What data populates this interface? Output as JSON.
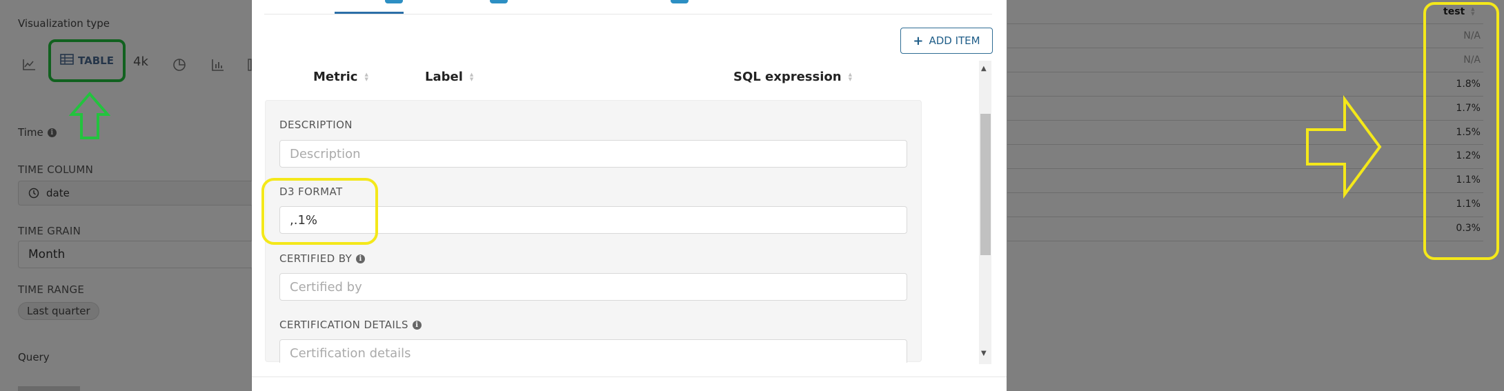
{
  "left_panel": {
    "visualization_type_label": "Visualization type",
    "table_button_label": "TABLE",
    "big_number_label": "4k",
    "time_section_label": "Time",
    "time_column_label": "TIME COLUMN",
    "time_column_value": "date",
    "time_grain_label": "TIME GRAIN",
    "time_grain_value": "Month",
    "time_range_label": "TIME RANGE",
    "time_range_value": "Last quarter",
    "query_section_label": "Query"
  },
  "modal": {
    "add_item_label": "ADD ITEM",
    "columns": [
      "Metric",
      "Label",
      "SQL expression"
    ],
    "description": {
      "label": "DESCRIPTION",
      "placeholder": "Description",
      "value": ""
    },
    "d3_format": {
      "label": "D3 FORMAT",
      "value": ",.1%"
    },
    "certified_by": {
      "label": "CERTIFIED BY",
      "placeholder": "Certified by",
      "value": ""
    },
    "certification_details": {
      "label": "CERTIFICATION DETAILS",
      "placeholder": "Certification details",
      "value": ""
    }
  },
  "results_table": {
    "header": "test",
    "rows": [
      "N/A",
      "N/A",
      "1.8%",
      "1.7%",
      "1.5%",
      "1.2%",
      "1.1%",
      "1.1%",
      "0.3%"
    ]
  },
  "annotation_colors": {
    "green": "#23c33e",
    "yellow": "#f4e81a"
  }
}
